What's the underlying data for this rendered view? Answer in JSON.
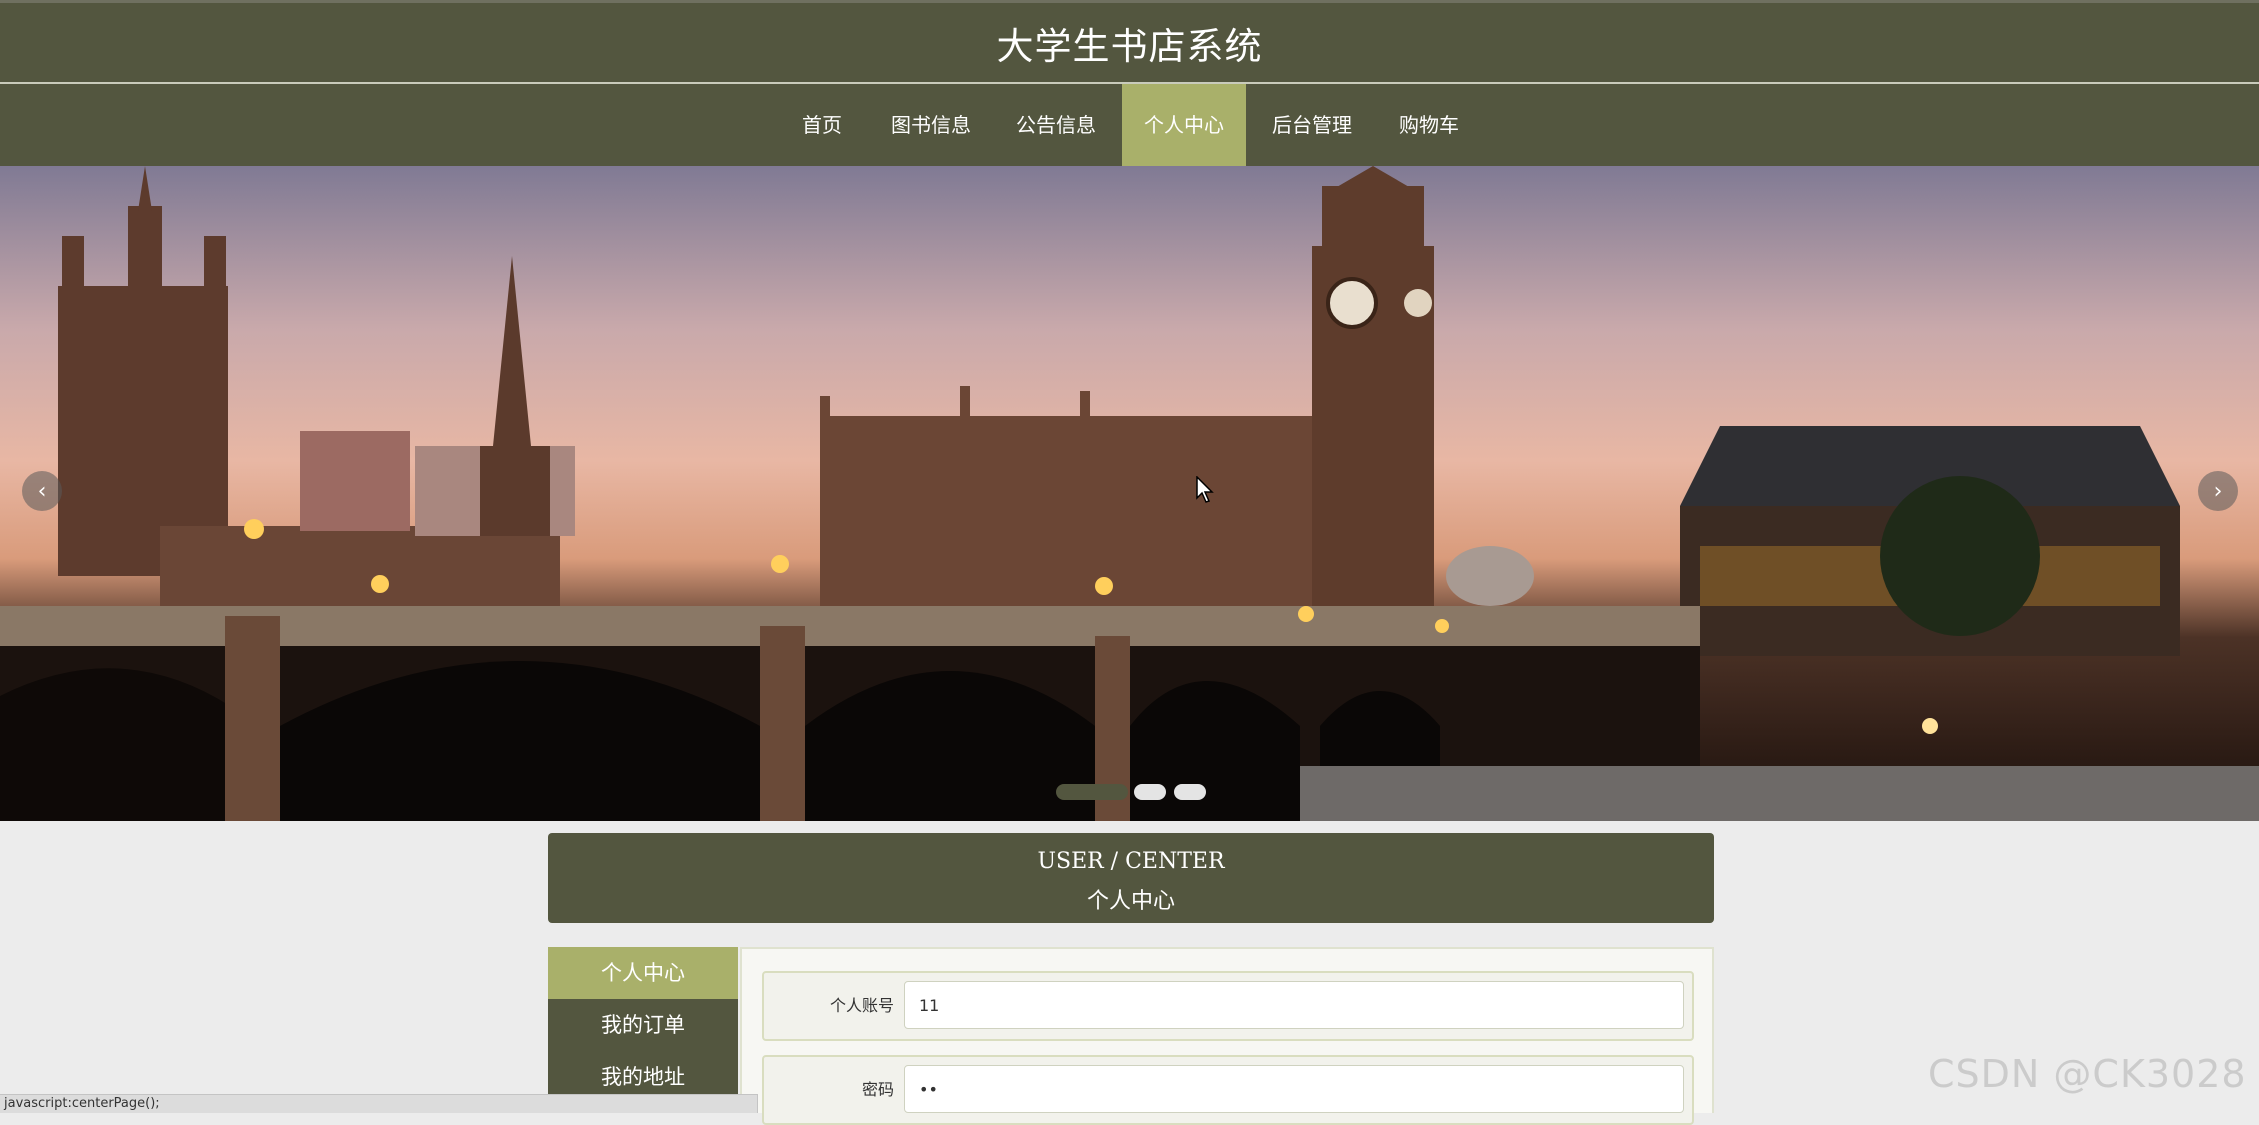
{
  "site": {
    "title": "大学生书店系统"
  },
  "nav": {
    "items": [
      {
        "label": "首页"
      },
      {
        "label": "图书信息"
      },
      {
        "label": "公告信息"
      },
      {
        "label": "个人中心",
        "active": true
      },
      {
        "label": "后台管理"
      },
      {
        "label": "购物车"
      }
    ]
  },
  "banner": {
    "prev_icon": "chevron-left-icon",
    "next_icon": "chevron-right-icon",
    "slide_count": 3,
    "active_slide": 1
  },
  "center": {
    "title_en": "USER / CENTER",
    "title_cn": "个人中心"
  },
  "side_menu": {
    "items": [
      {
        "label": "个人中心",
        "active": true
      },
      {
        "label": "我的订单"
      },
      {
        "label": "我的地址"
      }
    ]
  },
  "form": {
    "account_label": "个人账号",
    "account_value": "11",
    "password_label": "密码",
    "password_value": "••"
  },
  "status_bar": {
    "text": "javascript:centerPage();"
  },
  "watermark": {
    "text": "CSDN @CK3028"
  },
  "colors": {
    "primary": "#53563f",
    "accent": "#a9b06a",
    "background": "#ececec"
  }
}
